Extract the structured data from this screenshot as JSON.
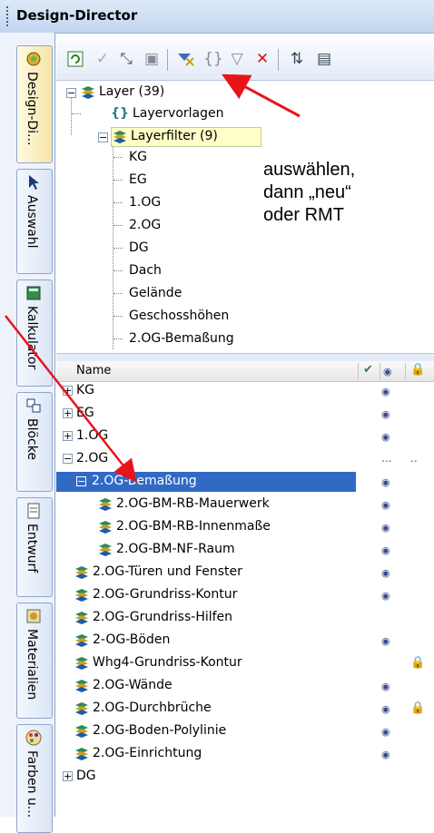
{
  "window": {
    "title": "Design-Director"
  },
  "side_tabs": [
    {
      "label": "Design-Di...",
      "icon": "design-director-icon"
    },
    {
      "label": "Auswahl",
      "icon": "cursor-icon"
    },
    {
      "label": "Kalkulator",
      "icon": "calculator-icon"
    },
    {
      "label": "Blöcke",
      "icon": "blocks-icon"
    },
    {
      "label": "Entwurf",
      "icon": "draft-icon"
    },
    {
      "label": "Materialien",
      "icon": "materials-icon"
    },
    {
      "label": "Farben u...",
      "icon": "palette-icon"
    }
  ],
  "tree": {
    "root": "Layer (39)",
    "templates": "Layervorlagen",
    "filter": "Layerfilter (9)",
    "filter_items": [
      "KG",
      "EG",
      "1.OG",
      "2.OG",
      "DG",
      "Dach",
      "Gelände",
      "Geschosshöhen",
      "2.OG-Bemaßung"
    ]
  },
  "annotation": {
    "line1": "auswählen,",
    "line2": "dann „neu“",
    "line3": "oder RMT"
  },
  "list": {
    "column_name": "Name",
    "rows": [
      {
        "label": "KG",
        "level": 0,
        "expander": "+",
        "eye": true,
        "lock": false
      },
      {
        "label": "EG",
        "level": 0,
        "expander": "+",
        "eye": true,
        "lock": false
      },
      {
        "label": "1.OG",
        "level": 0,
        "expander": "+",
        "eye": true,
        "lock": false
      },
      {
        "label": "2.OG",
        "level": 0,
        "expander": "−",
        "eye": false,
        "lock": false,
        "dots": true
      },
      {
        "label": "2.OG-Bemaßung",
        "level": 1,
        "expander": "−",
        "eye": true,
        "lock": false,
        "selected": true
      },
      {
        "label": "2.OG-BM-RB-Mauerwerk",
        "level": 2,
        "icon": true,
        "eye": true,
        "lock": false
      },
      {
        "label": "2.OG-BM-RB-Innenmaße",
        "level": 2,
        "icon": true,
        "eye": true,
        "lock": false
      },
      {
        "label": "2.OG-BM-NF-Raum",
        "level": 2,
        "icon": true,
        "eye": true,
        "lock": false
      },
      {
        "label": "2.OG-Türen und Fenster",
        "level": 1,
        "icon": true,
        "eye": true,
        "lock": false
      },
      {
        "label": "2.OG-Grundriss-Kontur",
        "level": 1,
        "icon": true,
        "eye": true,
        "lock": false
      },
      {
        "label": "2.OG-Grundriss-Hilfen",
        "level": 1,
        "icon": true,
        "eye": false,
        "lock": false
      },
      {
        "label": "2-OG-Böden",
        "level": 1,
        "icon": true,
        "eye": true,
        "lock": false
      },
      {
        "label": "Whg4-Grundriss-Kontur",
        "level": 1,
        "icon": true,
        "eye": false,
        "lock": true
      },
      {
        "label": "2.OG-Wände",
        "level": 1,
        "icon": true,
        "eye": true,
        "lock": false
      },
      {
        "label": "2.OG-Durchbrüche",
        "level": 1,
        "icon": true,
        "eye": true,
        "lock": true
      },
      {
        "label": "2.OG-Boden-Polylinie",
        "level": 1,
        "icon": true,
        "eye": true,
        "lock": false
      },
      {
        "label": "2.OG-Einrichtung",
        "level": 1,
        "icon": true,
        "eye": true,
        "lock": false
      },
      {
        "label": "DG",
        "level": 0,
        "expander": "+",
        "eye": false,
        "lock": false
      }
    ]
  },
  "colors": {
    "selection": "#316ac5",
    "arrow": "#e8141c",
    "title_bar": "#c3d6f0"
  }
}
